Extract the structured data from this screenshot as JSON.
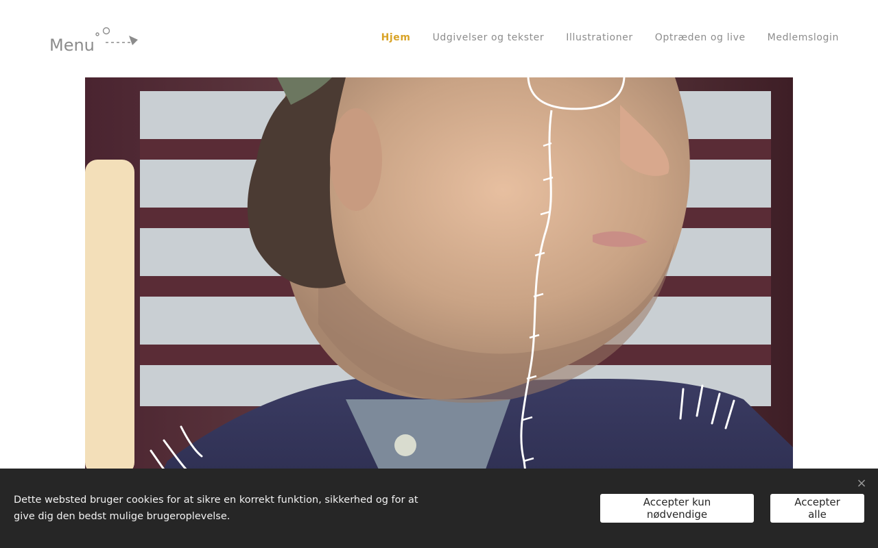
{
  "header": {
    "logo_text": "Menu",
    "nav": [
      {
        "label": "Hjem",
        "active": true
      },
      {
        "label": "Udgivelser og tekster",
        "active": false
      },
      {
        "label": "Illustrationer",
        "active": false
      },
      {
        "label": "Optræden og live",
        "active": false
      },
      {
        "label": "Medlemslogin",
        "active": false
      }
    ]
  },
  "hero": {
    "icon": "portrait-photo-with-doodle"
  },
  "cookie_banner": {
    "text": "Dette websted bruger cookies for at sikre en korrekt funktion, sikkerhed og for at give dig den bedst mulige brugeroplevelse.",
    "button_necessary": "Accepter kun nødvendige",
    "button_all": "Accepter alle",
    "close_icon": "close-icon"
  },
  "colors": {
    "accent": "#d9a326",
    "nav_text": "#8c8c8c",
    "banner_bg": "#262626"
  }
}
